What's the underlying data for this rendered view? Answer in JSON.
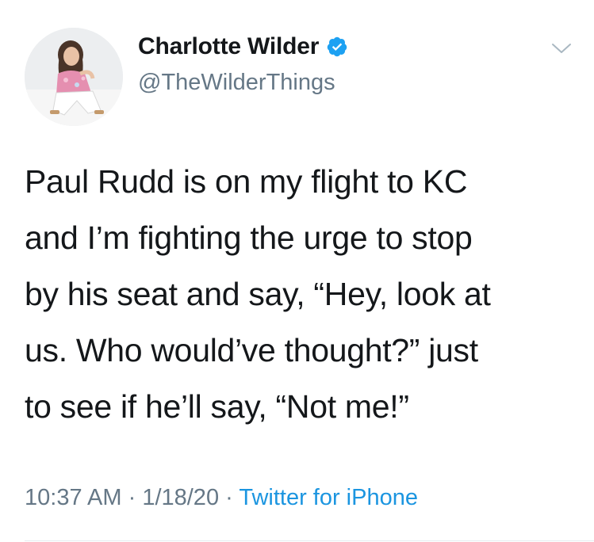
{
  "user": {
    "display_name": "Charlotte Wilder",
    "handle": "@TheWilderThings",
    "verified_icon": "verified-badge-icon",
    "avatar_icon": "profile-photo"
  },
  "menu": {
    "icon": "chevron-down-icon"
  },
  "tweet": {
    "lines": [
      "Paul Rudd is on my flight to KC",
      "and I’m fighting the urge to stop",
      "by his seat and say, “Hey, look at",
      "us. Who would’ve thought?” just",
      "to see if he’ll say, “Not me!”"
    ]
  },
  "meta": {
    "time": "10:37 AM",
    "separator": " · ",
    "date": "1/18/20",
    "source": "Twitter for iPhone"
  },
  "colors": {
    "text": "#14171a",
    "secondary": "#657786",
    "link": "#1b95e0",
    "verified": "#1da1f2"
  }
}
